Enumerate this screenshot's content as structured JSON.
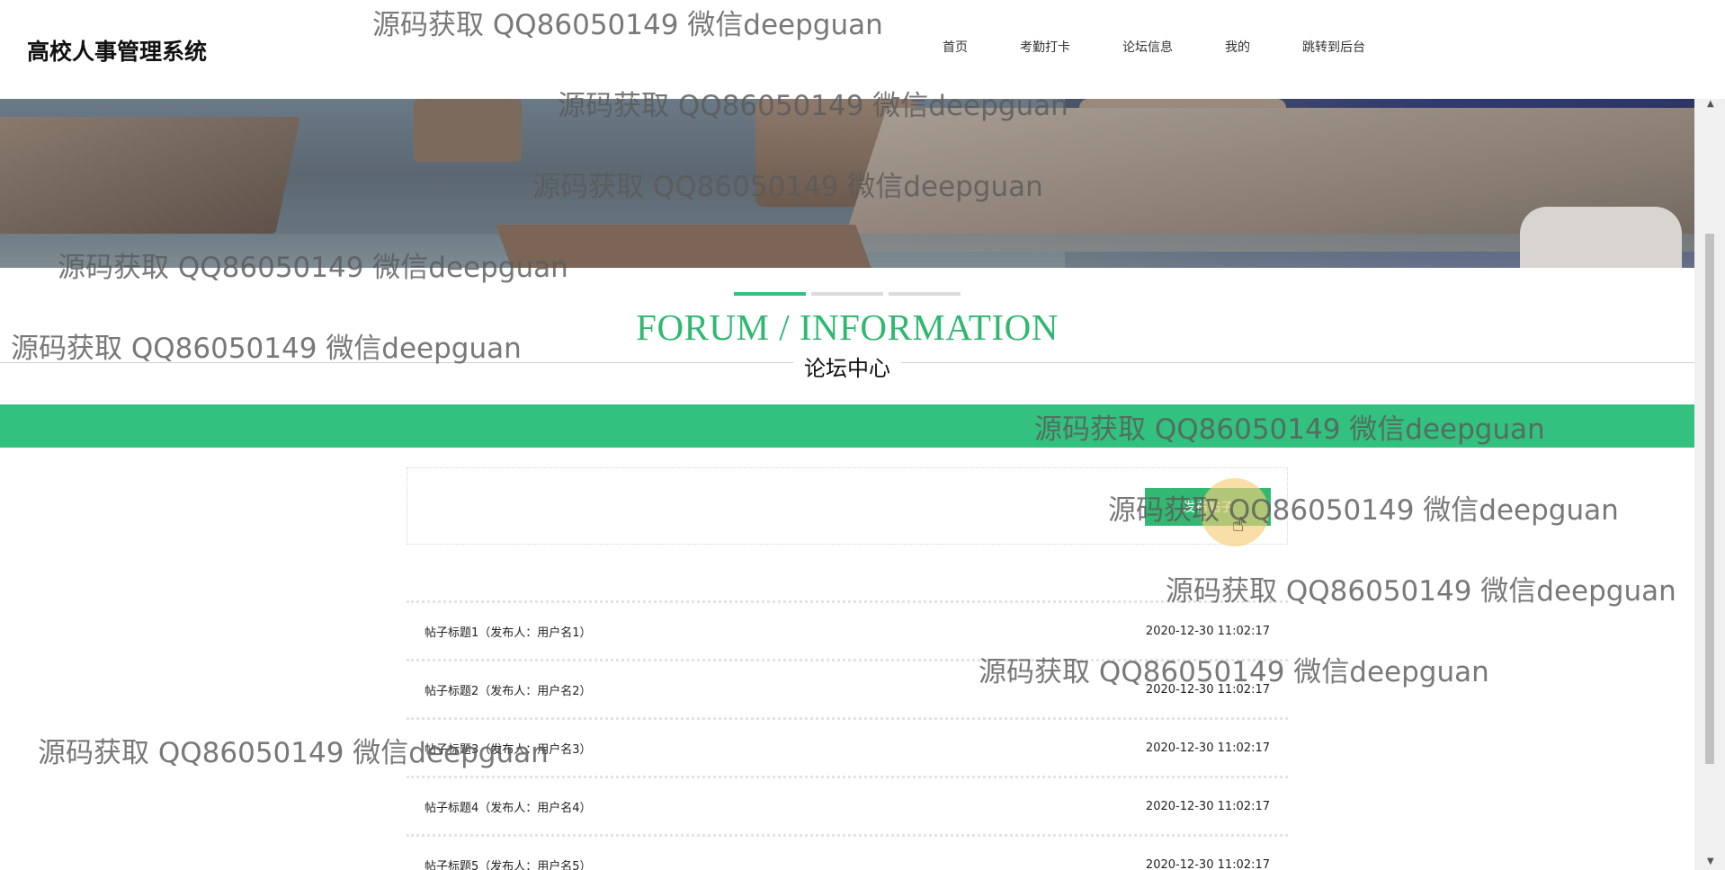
{
  "header": {
    "logo": "高校人事管理系统",
    "nav": [
      {
        "label": "首页"
      },
      {
        "label": "考勤打卡"
      },
      {
        "label": "论坛信息"
      },
      {
        "label": "我的"
      },
      {
        "label": "跳转到后台"
      }
    ]
  },
  "carousel": {
    "slide_count": 3,
    "active_index": 0
  },
  "section": {
    "title_en": "FORUM / INFORMATION",
    "title_cn": "论坛中心"
  },
  "post_button": {
    "label": "发布帖子"
  },
  "posts": [
    {
      "title": "帖子标题1（发布人：用户名1）",
      "date": "2020-12-30 11:02:17"
    },
    {
      "title": "帖子标题2（发布人：用户名2）",
      "date": "2020-12-30 11:02:17"
    },
    {
      "title": "帖子标题3（发布人：用户名3）",
      "date": "2020-12-30 11:02:17"
    },
    {
      "title": "帖子标题4（发布人：用户名4）",
      "date": "2020-12-30 11:02:17"
    },
    {
      "title": "帖子标题5（发布人：用户名5）",
      "date": "2020-12-30 11:02:17"
    }
  ],
  "watermark": "源码获取 QQ86050149 微信deepguan",
  "colors": {
    "accent": "#33c17f",
    "button": "#33b872"
  }
}
